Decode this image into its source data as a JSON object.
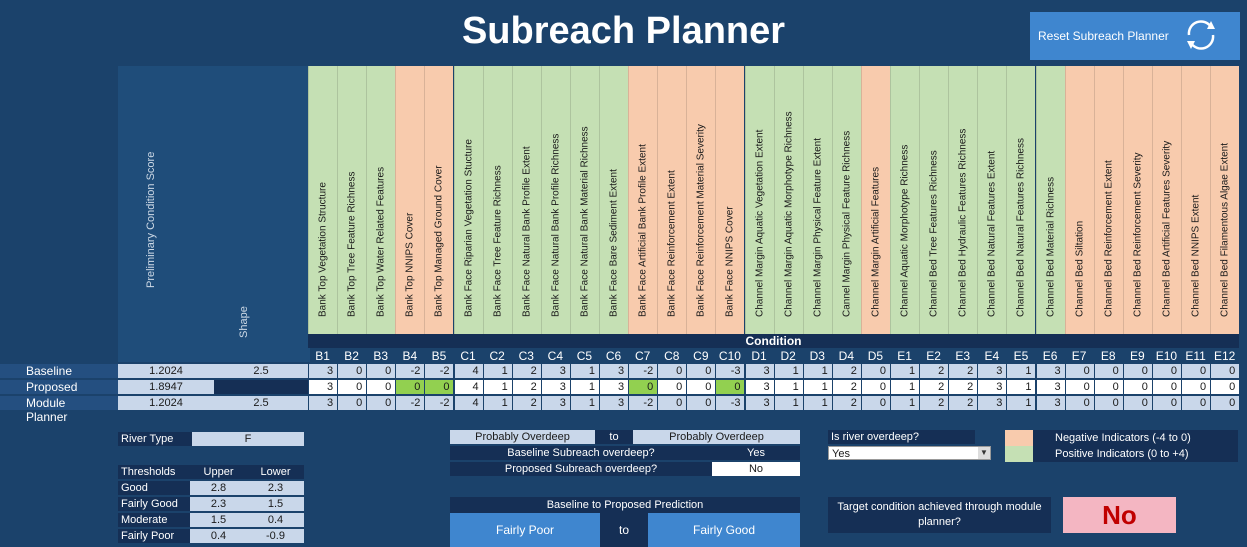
{
  "app": {
    "title": "Subreach Planner",
    "reset_label": "Reset Subreach Planner"
  },
  "score_headers": {
    "score": "Preliminary Condition Score",
    "shape": "Shape"
  },
  "condition_label": "Condition",
  "indicators": [
    {
      "code": "B1",
      "name": "Bank Top Vegetation Structure",
      "color": "green"
    },
    {
      "code": "B2",
      "name": "Bank Top Tree Feature Richness",
      "color": "green"
    },
    {
      "code": "B3",
      "name": "Bank Top Water Related Features",
      "color": "green"
    },
    {
      "code": "B4",
      "name": "Bank Top NNIPS Cover",
      "color": "orange"
    },
    {
      "code": "B5",
      "name": "Bank Top Managed Ground Cover",
      "color": "orange"
    },
    {
      "code": "C1",
      "name": "Bank Face Riparian Vegetation Stucture",
      "color": "green"
    },
    {
      "code": "C2",
      "name": "Bank Face Tree Feature Richness",
      "color": "green"
    },
    {
      "code": "C3",
      "name": "Bank Face Natural Bank Profile Extent",
      "color": "green"
    },
    {
      "code": "C4",
      "name": "Bank Face Natural Bank Profile Richness",
      "color": "green"
    },
    {
      "code": "C5",
      "name": "Bank Face Natural Bank Material Richness",
      "color": "green"
    },
    {
      "code": "C6",
      "name": "Bank Face Bare Sediment Extent",
      "color": "green"
    },
    {
      "code": "C7",
      "name": "Bank Face Artificial Bank Profile Extent",
      "color": "orange"
    },
    {
      "code": "C8",
      "name": "Bank Face Reinforcement Extent",
      "color": "orange"
    },
    {
      "code": "C9",
      "name": "Bank Face Reinforcement Material Severity",
      "color": "orange"
    },
    {
      "code": "C10",
      "name": "Bank Face NNIPS Cover",
      "color": "orange"
    },
    {
      "code": "D1",
      "name": "Channel Margin Aquatic Vegetation Extent",
      "color": "green"
    },
    {
      "code": "D2",
      "name": "Channel Margin Aquatic Morphotype Richness",
      "color": "green"
    },
    {
      "code": "D3",
      "name": "Channel Margin Physical Feature Extent",
      "color": "green"
    },
    {
      "code": "D4",
      "name": "Cannel Margin Physical Feature Richness",
      "color": "green"
    },
    {
      "code": "D5",
      "name": "Channel Margin Artificial Features",
      "color": "orange"
    },
    {
      "code": "E1",
      "name": "Channel Aquatic Morphotype Richness",
      "color": "green"
    },
    {
      "code": "E2",
      "name": "Channel Bed Tree Features Richness",
      "color": "green"
    },
    {
      "code": "E3",
      "name": "Channel Bed Hydraulic Features Richness",
      "color": "green"
    },
    {
      "code": "E4",
      "name": "Channel Bed Natural Features Extent",
      "color": "green"
    },
    {
      "code": "E5",
      "name": "Channel Bed Natural Features Richness",
      "color": "green"
    },
    {
      "code": "E6",
      "name": "Channel Bed Material Richness",
      "color": "green"
    },
    {
      "code": "E7",
      "name": "Channel Bed Siltation",
      "color": "orange"
    },
    {
      "code": "E8",
      "name": "Channel Bed Reinforcement Extent",
      "color": "orange"
    },
    {
      "code": "E9",
      "name": "Channel Bed Reinforcement Severity",
      "color": "orange"
    },
    {
      "code": "E10",
      "name": "Channel Bed Artificial Features Severity",
      "color": "orange"
    },
    {
      "code": "E11",
      "name": "Channel Bed NNIPS Extent",
      "color": "orange"
    },
    {
      "code": "E12",
      "name": "Channel Bed Filamentous Algae Extent",
      "color": "orange"
    }
  ],
  "rows": [
    {
      "label": "Baseline",
      "score": "1.2024",
      "shape": "2.5",
      "values": [
        "3",
        "0",
        "0",
        "-2",
        "-2",
        "4",
        "1",
        "2",
        "3",
        "1",
        "3",
        "-2",
        "0",
        "0",
        "-3",
        "3",
        "1",
        "1",
        "2",
        "0",
        "1",
        "2",
        "2",
        "3",
        "1",
        "3",
        "0",
        "0",
        "0",
        "0",
        "0",
        "0"
      ]
    },
    {
      "label": "Proposed",
      "score": "1.8947",
      "shape": "",
      "values": [
        "3",
        "0",
        "0",
        "0",
        "0",
        "4",
        "1",
        "2",
        "3",
        "1",
        "3",
        "0",
        "0",
        "0",
        "0",
        "3",
        "1",
        "1",
        "2",
        "0",
        "1",
        "2",
        "2",
        "3",
        "1",
        "3",
        "0",
        "0",
        "0",
        "0",
        "0",
        "0"
      ]
    },
    {
      "label": "Module Planner",
      "score": "1.2024",
      "shape": "2.5",
      "values": [
        "3",
        "0",
        "0",
        "-2",
        "-2",
        "4",
        "1",
        "2",
        "3",
        "1",
        "3",
        "-2",
        "0",
        "0",
        "-3",
        "3",
        "1",
        "1",
        "2",
        "0",
        "1",
        "2",
        "2",
        "3",
        "1",
        "3",
        "0",
        "0",
        "0",
        "0",
        "0",
        "0"
      ]
    }
  ],
  "highlighted_proposed": [
    "B4",
    "B5",
    "C7",
    "C10"
  ],
  "river_type": {
    "label": "River Type",
    "value": "F"
  },
  "thresholds": {
    "headers": [
      "Thresholds",
      "Upper",
      "Lower"
    ],
    "rows": [
      [
        "Good",
        "2.8",
        "2.3"
      ],
      [
        "Fairly Good",
        "2.3",
        "1.5"
      ],
      [
        "Moderate",
        "1.5",
        "0.4"
      ],
      [
        "Fairly Poor",
        "0.4",
        "-0.9"
      ]
    ]
  },
  "overdeep": {
    "from": "Probably Overdeep",
    "to_word": "to",
    "to": "Probably Overdeep",
    "baseline_q": "Baseline Subreach overdeep?",
    "baseline_a": "Yes",
    "proposed_q": "Proposed Subreach overdeep?",
    "proposed_a": "No"
  },
  "prediction": {
    "title": "Baseline to Proposed Prediction",
    "from": "Fairly Poor",
    "to_word": "to",
    "to": "Fairly Good"
  },
  "river_overdeep": {
    "question": "Is river overdeep?",
    "selected": "Yes"
  },
  "legend": {
    "negative": "Negative Indicators (-4 to 0)",
    "positive": "Positive Indicators (0 to +4)"
  },
  "target": {
    "question": "Target condition achieved through module planner?",
    "answer": "No"
  },
  "colors": {
    "green": "#c5e0b4",
    "orange": "#f8cbad",
    "highlight": "#92d050",
    "background": "#1b426b",
    "answer_bg": "#f4b6c2",
    "answer_fg": "#c00000"
  }
}
